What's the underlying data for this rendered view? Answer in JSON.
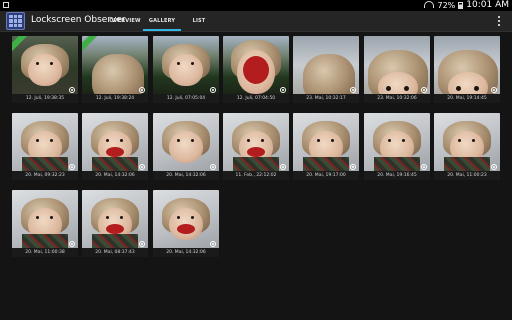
{
  "status_bar": {
    "battery": "72%",
    "time": "10:01 AM"
  },
  "app": {
    "title": "Lockscreen Observer"
  },
  "tabs": [
    {
      "label": "OVERVIEW",
      "active": false
    },
    {
      "label": "GALLERY",
      "active": true
    },
    {
      "label": "LIST",
      "active": false
    }
  ],
  "accent_color": "#33b5e5",
  "gallery": [
    {
      "caption": "12. Juli, 19:38:35",
      "variant": "face",
      "scene": "sky-dark",
      "badge": true
    },
    {
      "caption": "12. Juli, 19:38:24",
      "variant": "hairtop",
      "scene": "sky-trees",
      "badge": true
    },
    {
      "caption": "12. Juli, 07:05:04",
      "variant": "face",
      "scene": "sky-trees",
      "badge": false
    },
    {
      "caption": "12. Juli, 07:04:50",
      "variant": "mouth-open",
      "scene": "sky-trees",
      "badge": false
    },
    {
      "caption": "23. Mai, 10:32:17",
      "variant": "hairtop",
      "scene": "sky-light",
      "badge": false
    },
    {
      "caption": "23. Mai, 10:32:06",
      "variant": "eyes",
      "scene": "sky-light",
      "badge": false
    },
    {
      "caption": "20. Mai, 19:14:45",
      "variant": "eyes",
      "scene": "sky-light",
      "badge": false
    },
    {
      "caption": "20. Mai, 09:32:23",
      "variant": "full",
      "scene": "wall",
      "badge": false
    },
    {
      "caption": "20. Mai, 14:32:06",
      "variant": "full-mouth",
      "scene": "wall",
      "badge": false
    },
    {
      "caption": "20. Mai, 14:32:06",
      "variant": "face",
      "scene": "wall",
      "badge": false
    },
    {
      "caption": "11. Feb., 22:12:02",
      "variant": "small-mouth",
      "scene": "wall",
      "badge": false
    },
    {
      "caption": "20. Mai, 19:17:00",
      "variant": "full",
      "scene": "wall",
      "badge": false
    },
    {
      "caption": "20. Mai, 19:16:45",
      "variant": "full",
      "scene": "wall",
      "badge": false
    },
    {
      "caption": "20. Mai, 11:00:23",
      "variant": "full",
      "scene": "wall",
      "badge": false
    },
    {
      "caption": "20. Mai, 11:00:38",
      "variant": "full",
      "scene": "wall",
      "badge": false
    },
    {
      "caption": "20. Mai, 08:37:43",
      "variant": "full-mouth",
      "scene": "wall",
      "badge": false
    },
    {
      "caption": "20. Mai, 14:32:06",
      "variant": "face-mouth",
      "scene": "wall",
      "badge": false
    }
  ]
}
